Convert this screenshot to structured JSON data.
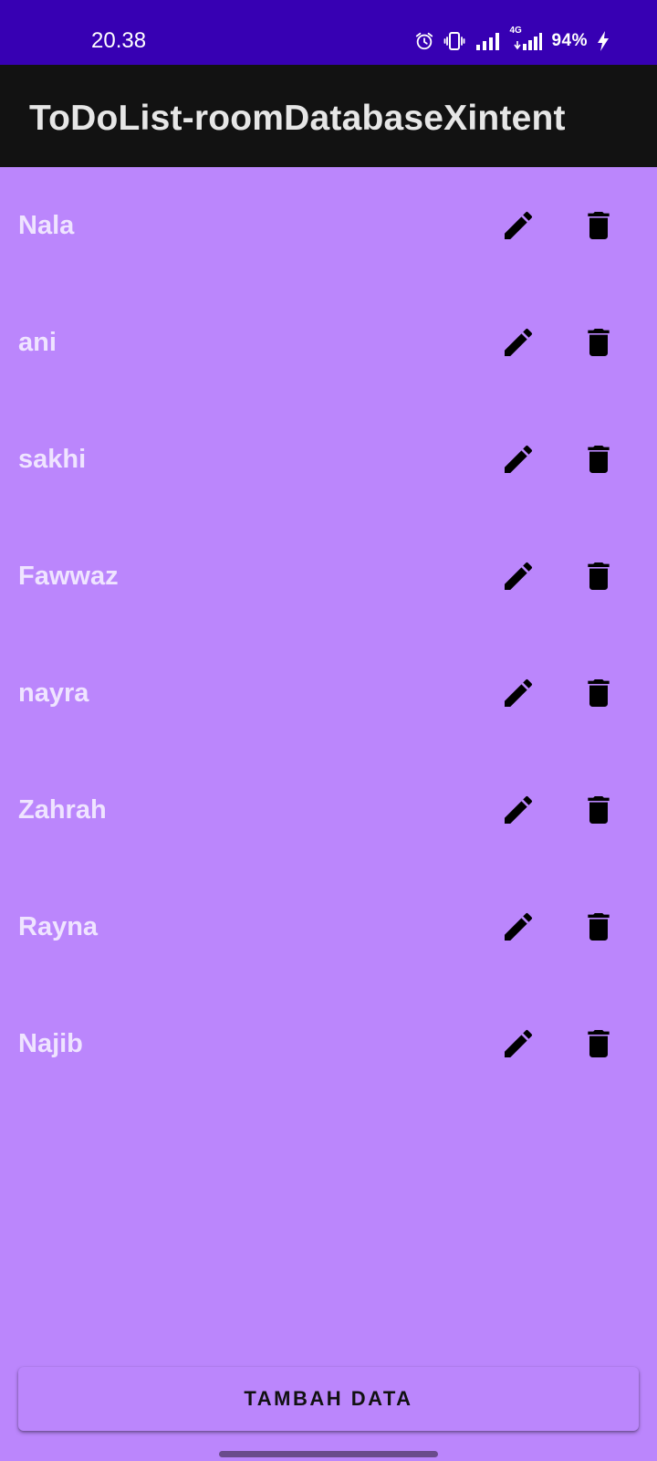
{
  "status_bar": {
    "time": "20.38",
    "network": "4G",
    "battery": "94%",
    "icons": [
      "alarm-icon",
      "vibrate-icon",
      "signal-icon",
      "signal-4g-icon",
      "charging-icon"
    ]
  },
  "app_bar": {
    "title": "ToDoList-roomDatabaseXintent"
  },
  "todo_items": [
    {
      "name": "Nala"
    },
    {
      "name": "ani"
    },
    {
      "name": "sakhi"
    },
    {
      "name": "Fawwaz"
    },
    {
      "name": "nayra"
    },
    {
      "name": "Zahrah"
    },
    {
      "name": "Rayna"
    },
    {
      "name": "Najib"
    }
  ],
  "item_actions": {
    "edit_icon": "pencil-icon",
    "delete_icon": "trash-icon"
  },
  "footer": {
    "add_button_label": "TAMBAH DATA"
  },
  "colors": {
    "status_bar": "#3700b3",
    "app_bar": "#121212",
    "background": "#bb86fc",
    "item_text": "#efe4ff",
    "icon": "#000000"
  }
}
